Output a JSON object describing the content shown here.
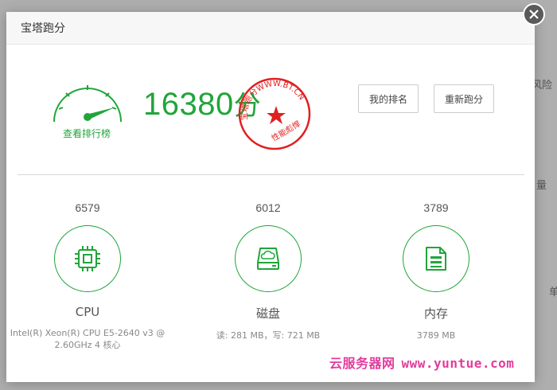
{
  "background": {
    "side_text_1": "风险",
    "side_text_2": "量",
    "side_text_3": "单"
  },
  "modal": {
    "title": "宝塔跑分",
    "close_icon": "close-icon"
  },
  "summary": {
    "rank_link": "查看排行榜",
    "total_score": "16380",
    "score_unit": "分",
    "stamp_text": "宝塔跑分WWW.BT.CN",
    "stamp_subtext": "性能彪悍",
    "my_rank_button": "我的排名",
    "rerun_button": "重新跑分"
  },
  "metrics": [
    {
      "score": "6579",
      "name": "CPU",
      "detail": "Intel(R) Xeon(R) CPU E5-2640 v3 @ 2.60GHz 4 核心",
      "icon": "cpu-icon"
    },
    {
      "score": "6012",
      "name": "磁盘",
      "detail": "读: 281 MB，写: 721 MB",
      "icon": "disk-icon"
    },
    {
      "score": "3789",
      "name": "内存",
      "detail": "3789 MB",
      "icon": "memory-icon"
    }
  ],
  "watermark": {
    "site_name": "云服务器网",
    "site_url": "www.yuntue.com"
  },
  "colors": {
    "accent": "#20a53a",
    "stamp": "#e02020",
    "watermark": "#e33c9c"
  }
}
